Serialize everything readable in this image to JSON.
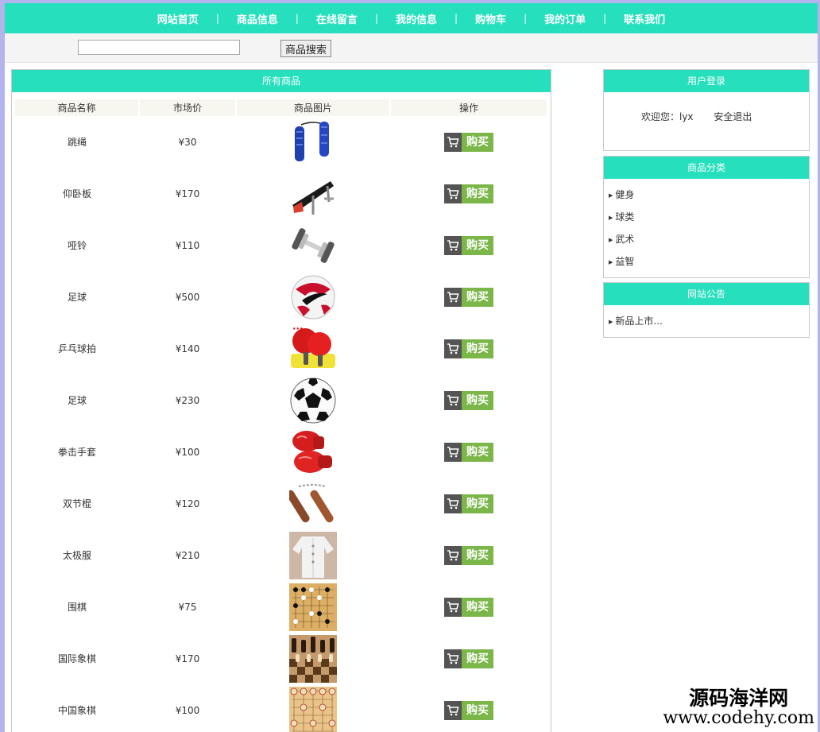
{
  "nav": {
    "items": [
      "网站首页",
      "商品信息",
      "在线留言",
      "我的信息",
      "购物车",
      "我的订单",
      "联系我们"
    ],
    "separator": "|"
  },
  "search": {
    "value": "",
    "button": "商品搜索"
  },
  "main": {
    "title": "所有商品",
    "columns": [
      "商品名称",
      "市场价",
      "商品图片",
      "操作"
    ],
    "buy_label": "购买",
    "rows": [
      {
        "name": "跳绳",
        "price": "¥30",
        "thumb": "jump-rope"
      },
      {
        "name": "仰卧板",
        "price": "¥170",
        "thumb": "sit-up-bench"
      },
      {
        "name": "哑铃",
        "price": "¥110",
        "thumb": "dumbbell"
      },
      {
        "name": "足球",
        "price": "¥500",
        "thumb": "soccer-ball-red"
      },
      {
        "name": "乒乓球拍",
        "price": "¥140",
        "thumb": "ping-pong-paddles"
      },
      {
        "name": "足球",
        "price": "¥230",
        "thumb": "soccer-ball-classic"
      },
      {
        "name": "拳击手套",
        "price": "¥100",
        "thumb": "boxing-gloves"
      },
      {
        "name": "双节棍",
        "price": "¥120",
        "thumb": "nunchaku"
      },
      {
        "name": "太极服",
        "price": "¥210",
        "thumb": "tai-chi-suit"
      },
      {
        "name": "围棋",
        "price": "¥75",
        "thumb": "go-board"
      },
      {
        "name": "国际象棋",
        "price": "¥170",
        "thumb": "chess-board"
      },
      {
        "name": "中国象棋",
        "price": "¥100",
        "thumb": "xiangqi-board"
      }
    ]
  },
  "login": {
    "title": "用户登录",
    "welcome": "欢迎您：lyx",
    "logout": "安全退出"
  },
  "categories": {
    "title": "商品分类",
    "items": [
      "健身",
      "球类",
      "武术",
      "益智"
    ]
  },
  "notice": {
    "title": "网站公告",
    "items": [
      "新品上市..."
    ]
  },
  "watermark": {
    "line1": "源码海洋网",
    "line2": "www.codehy.com"
  },
  "colors": {
    "accent": "#26e0bd",
    "buy_green": "#7ab648",
    "cart_gray": "#545454",
    "outer_bg": "#b3b3ee"
  }
}
